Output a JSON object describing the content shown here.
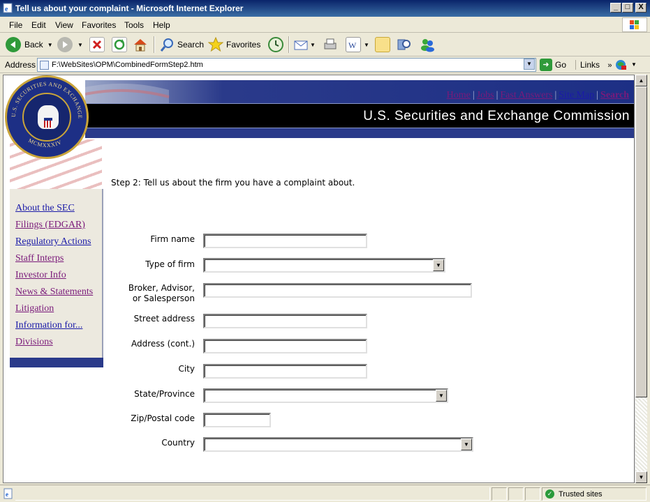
{
  "window": {
    "title": "Tell us about your complaint - Microsoft Internet Explorer",
    "controls": [
      "_",
      "□",
      "X"
    ]
  },
  "menu": [
    "File",
    "Edit",
    "View",
    "Favorites",
    "Tools",
    "Help"
  ],
  "toolbar": {
    "back": "Back",
    "search": "Search",
    "favorites": "Favorites"
  },
  "address": {
    "label": "Address",
    "url": "F:\\WebSites\\OPM\\CombinedFormStep2.htm",
    "go": "Go",
    "links": "Links"
  },
  "header": {
    "title": "U.S. Securities and Exchange Commission",
    "links": [
      "Home",
      "Jobs",
      "Fast Answers",
      "Site Map",
      "Search"
    ],
    "seal_text": "U.S. SECURITIES AND EXCHANGE COMMISSION",
    "seal_year": "MCMXXXIV"
  },
  "nav": [
    "About the SEC",
    "Filings (EDGAR)",
    "Regulatory Actions",
    "Staff Interps",
    "Investor Info",
    "News & Statements",
    "Litigation",
    "Information for...",
    "Divisions"
  ],
  "form": {
    "step": "Step 2: Tell us about the firm you have a complaint about.",
    "fields": {
      "firm_name": "Firm name",
      "type_of_firm": "Type of firm",
      "broker_line1": "Broker, Advisor,",
      "broker_line2": "or Salesperson",
      "street": "Street address",
      "address_cont": "Address (cont.)",
      "city": "City",
      "state": "State/Province",
      "zip": "Zip/Postal code",
      "country": "Country"
    }
  },
  "status": {
    "zone": "Trusted sites"
  },
  "colors": {
    "banner_blue": "#1d2f85",
    "visited_link": "#7a1a7a",
    "link": "#1a1aa8"
  }
}
